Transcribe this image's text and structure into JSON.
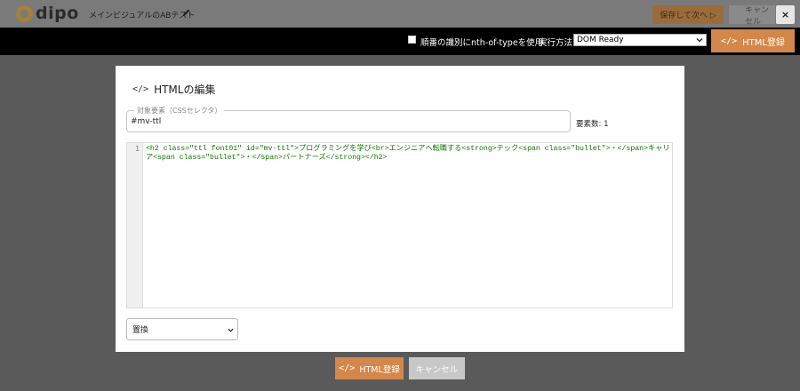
{
  "header": {
    "logo_text": "dipo",
    "page_name": "メインビジュアルのABテスト",
    "save_next_label": "保存して次へ ▷",
    "cancel_label": "キャンセル",
    "close_label": "×"
  },
  "options_bar": {
    "nth_of_type_label": "順番の識別にnth-of-typeを使用",
    "nth_of_type_checked": false,
    "exec_method_label": "実行方法:",
    "exec_method_value": "DOM Ready",
    "html_register_label": "HTML登録"
  },
  "modal": {
    "title": "HTMLの編集",
    "code_icon": "</>",
    "target_legend": "対象要素（CSSセレクタ）",
    "target_value": "#mv-ttl",
    "element_count_label": "要素数: 1",
    "editor": {
      "line_number": "1",
      "code": "<h2 class=\"ttl font01\" id=\"mv-ttl\">プログラミングを学び<br>エンジニアへ転職する<strong>テック<span class=\"bullet\">・</span>キャリア<span class=\"bullet\">・</span>パートナーズ</strong></h2>"
    },
    "mode_value": "置換"
  },
  "footer": {
    "html_register_label": "HTML登録",
    "cancel_label": "キャンセル"
  },
  "colors": {
    "accent": "#d4874a",
    "overlay": "#5a5a5a",
    "code_text": "#117700"
  }
}
